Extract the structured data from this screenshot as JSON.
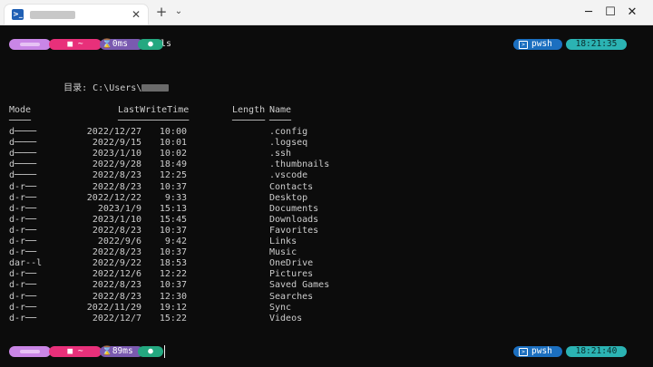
{
  "titlebar": {
    "tab_icon": "powershell-icon",
    "tab_close": "✕",
    "new_tab": "+",
    "dropdown": "⌄",
    "minimize": "─",
    "maximize": "☐",
    "close": "✕"
  },
  "prompt1": {
    "user_icon": "user-icon",
    "path": "■ ~",
    "exec_time": "⌛0ms",
    "status_icon": "●",
    "command": "ls",
    "shell": "pwsh",
    "clock": "18:21:35"
  },
  "listing": {
    "directory_label": "目录: C:\\Users\\",
    "headers": {
      "mode": "Mode",
      "lastwrite": "LastWriteTime",
      "length": "Length",
      "name": "Name"
    },
    "underline_mode": "────",
    "underline_lastwrite": "─────────────",
    "underline_length": "──────",
    "underline_name": "────",
    "rows": [
      {
        "mode": "d────",
        "date": "2022/12/27",
        "time": "10:00",
        "name": ".config"
      },
      {
        "mode": "d────",
        "date": "2022/9/15",
        "time": "10:01",
        "name": ".logseq"
      },
      {
        "mode": "d────",
        "date": "2023/1/10",
        "time": "10:02",
        "name": ".ssh"
      },
      {
        "mode": "d────",
        "date": "2022/9/28",
        "time": "18:49",
        "name": ".thumbnails"
      },
      {
        "mode": "d────",
        "date": "2022/8/23",
        "time": "12:25",
        "name": ".vscode"
      },
      {
        "mode": "d-r──",
        "date": "2022/8/23",
        "time": "10:37",
        "name": "Contacts"
      },
      {
        "mode": "d-r──",
        "date": "2022/12/22",
        "time": "9:33",
        "name": "Desktop"
      },
      {
        "mode": "d-r──",
        "date": "2023/1/9",
        "time": "15:13",
        "name": "Documents"
      },
      {
        "mode": "d-r──",
        "date": "2023/1/10",
        "time": "15:45",
        "name": "Downloads"
      },
      {
        "mode": "d-r──",
        "date": "2022/8/23",
        "time": "10:37",
        "name": "Favorites"
      },
      {
        "mode": "d-r──",
        "date": "2022/9/6",
        "time": "9:42",
        "name": "Links"
      },
      {
        "mode": "d-r──",
        "date": "2022/8/23",
        "time": "10:37",
        "name": "Music"
      },
      {
        "mode": "dar--l",
        "date": "2022/9/22",
        "time": "18:53",
        "name": "OneDrive"
      },
      {
        "mode": "d-r──",
        "date": "2022/12/6",
        "time": "12:22",
        "name": "Pictures"
      },
      {
        "mode": "d-r──",
        "date": "2022/8/23",
        "time": "10:37",
        "name": "Saved Games"
      },
      {
        "mode": "d-r──",
        "date": "2022/8/23",
        "time": "12:30",
        "name": "Searches"
      },
      {
        "mode": "d-r──",
        "date": "2022/11/29",
        "time": "19:12",
        "name": "Sync"
      },
      {
        "mode": "d-r──",
        "date": "2022/12/7",
        "time": "15:22",
        "name": "Videos"
      }
    ]
  },
  "prompt2": {
    "user_icon": "user-icon",
    "path": "■ ~",
    "exec_time": "⌛89ms",
    "status_icon": "●",
    "shell": "pwsh",
    "clock": "18:21:40"
  }
}
